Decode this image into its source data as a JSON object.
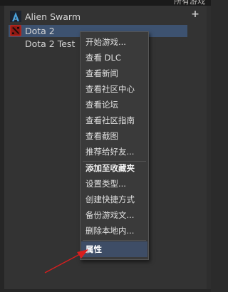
{
  "header": {
    "link_text": "所有游戏"
  },
  "games": [
    {
      "name": "Alien Swarm",
      "icon": "alien-swarm-icon",
      "selected": false
    },
    {
      "name": "Dota 2",
      "icon": "dota2-icon",
      "selected": true
    },
    {
      "name": "Dota 2 Test",
      "icon": "",
      "selected": false
    }
  ],
  "context_menu": {
    "items": [
      {
        "label": "开始游戏..."
      },
      {
        "label": "查看 DLC"
      },
      {
        "label": "查看新闻"
      },
      {
        "label": "查看社区中心"
      },
      {
        "label": "查看论坛"
      },
      {
        "label": "查看社区指南"
      },
      {
        "label": "查看截图"
      },
      {
        "label": "推荐给好友..."
      },
      {
        "label": "添加至收藏夹"
      },
      {
        "label": "设置类型..."
      },
      {
        "label": "创建快捷方式"
      },
      {
        "label": "备份游戏文..."
      },
      {
        "label": "删除本地内..."
      },
      {
        "label": "属性"
      }
    ]
  },
  "colors": {
    "selection": "#3d5270",
    "menu_background": "#3a3a3a",
    "menu_highlight": "#3e4d66",
    "annotation_arrow": "#d81e1e"
  }
}
